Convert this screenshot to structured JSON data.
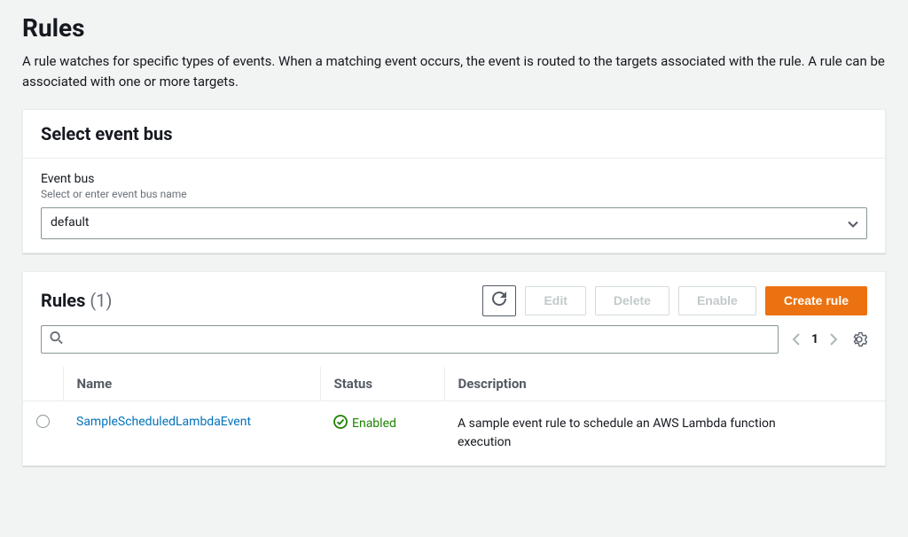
{
  "page": {
    "title": "Rules",
    "description": "A rule watches for specific types of events. When a matching event occurs, the event is routed to the targets associated with the rule. A rule can be associated with one or more targets."
  },
  "eventBus": {
    "panelTitle": "Select event bus",
    "fieldLabel": "Event bus",
    "fieldHint": "Select or enter event bus name",
    "value": "default"
  },
  "rulesPanel": {
    "titleText": "Rules",
    "count": "(1)",
    "actions": {
      "edit": "Edit",
      "delete": "Delete",
      "enable": "Enable",
      "create": "Create rule"
    },
    "search": {
      "placeholder": ""
    },
    "pager": {
      "page": "1"
    },
    "columns": {
      "name": "Name",
      "status": "Status",
      "description": "Description"
    },
    "rows": [
      {
        "name": "SampleScheduledLambdaEvent",
        "status": "Enabled",
        "description": "A sample event rule to schedule an AWS Lambda function execution"
      }
    ]
  }
}
